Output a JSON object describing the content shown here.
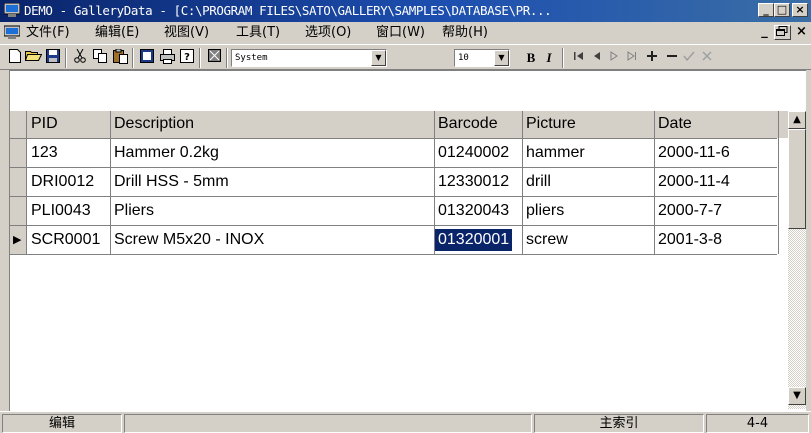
{
  "titlebar": {
    "title": "DEMO - GalleryData - [C:\\PROGRAM FILES\\SATO\\GALLERY\\SAMPLES\\DATABASE\\PR...",
    "min": "_",
    "max": "□",
    "close": "×"
  },
  "menubar": {
    "items": [
      "文件(F)",
      "编辑(E)",
      "视图(V)",
      "工具(T)",
      "选项(O)",
      "窗口(W)",
      "帮助(H)"
    ],
    "mdi_min": "_",
    "mdi_restore": "🗗",
    "mdi_close": "×"
  },
  "toolbar": {
    "font_name": "System",
    "font_size": "10",
    "bold": "B",
    "italic": "I",
    "icons": [
      "new-icon",
      "open-icon",
      "save-icon",
      "cut-icon",
      "copy-icon",
      "paste-icon",
      "design-icon",
      "print-icon",
      "help-icon",
      "grid-icon"
    ],
    "nav_icons": [
      "first-record-icon",
      "prev-record-icon",
      "next-record-icon",
      "last-record-icon",
      "add-record-icon",
      "delete-record-icon",
      "confirm-icon",
      "cancel-icon"
    ]
  },
  "grid": {
    "columns": [
      "PID",
      "Description",
      "Barcode",
      "Picture",
      "Date"
    ],
    "rows": [
      [
        "123",
        "Hammer 0.2kg",
        "01240002",
        "hammer",
        "2000-11-6"
      ],
      [
        "DRI0012",
        "Drill HSS - 5mm",
        "12330012",
        "drill",
        "2000-11-4"
      ],
      [
        "PLI0043",
        "Pliers",
        "01320043",
        "pliers",
        "2000-7-7"
      ],
      [
        "SCR0001",
        "Screw M5x20 - INOX",
        "01320001",
        "screw",
        "2001-3-8"
      ]
    ],
    "current_row_marker": "▶"
  },
  "statusbar": {
    "mode": "编辑",
    "index": "主索引",
    "position": "4-4"
  },
  "colors": {
    "title_bg": "#0a246a",
    "selection_bg": "#0a246a",
    "face": "#d4d0c8"
  }
}
